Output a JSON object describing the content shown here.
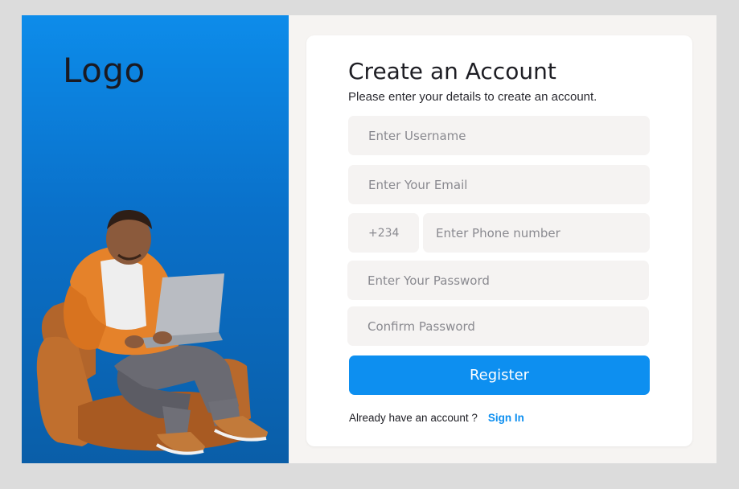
{
  "brand": {
    "logo_text": "Logo"
  },
  "illustration": {
    "icon": "man-on-couch-with-laptop"
  },
  "form": {
    "title": "Create an Account",
    "subtitle": "Please enter your details to create an account.",
    "username": {
      "placeholder": "Enter Username",
      "value": ""
    },
    "email": {
      "placeholder": "Enter Your Email",
      "value": ""
    },
    "phone_code": "+234",
    "phone": {
      "placeholder": "Enter Phone number",
      "value": ""
    },
    "password": {
      "placeholder": "Enter Your Password",
      "value": ""
    },
    "confirm_password": {
      "placeholder": "Confirm Password",
      "value": ""
    },
    "register_label": "Register",
    "footer_text": "Already have an account ?",
    "signin_label": "Sign In"
  },
  "colors": {
    "accent": "#0d8ff0",
    "panel_top": "#0d8cea",
    "panel_bottom": "#0a5ea8",
    "field_bg": "#f5f3f2"
  }
}
